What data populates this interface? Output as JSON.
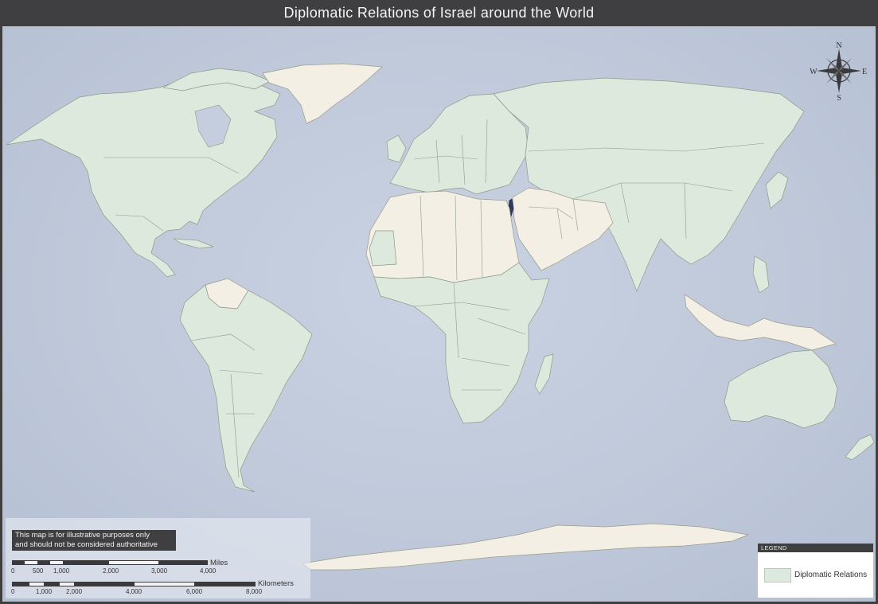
{
  "title": "Diplomatic Relations of Israel around the World",
  "compass": {
    "north": "N",
    "south": "S",
    "east": "E",
    "west": "W"
  },
  "colors": {
    "ocean": "#c4cede",
    "relations": "#dce9dc",
    "no_relations": "#f3efe4",
    "israel": "#2e3a5c",
    "bar": "#3f3f41"
  },
  "disclaimer": {
    "line1": "This map is for illustrative purposes only",
    "line2": "and should not be considered authoritative"
  },
  "scale": {
    "miles": {
      "unit": "Miles",
      "ticks": [
        "0",
        "500",
        "1,000",
        "2,000",
        "3,000",
        "4,000"
      ]
    },
    "kilometers": {
      "unit": "Kilometers",
      "ticks": [
        "0",
        "1,000",
        "2,000",
        "4,000",
        "6,000",
        "8,000"
      ]
    }
  },
  "legend": {
    "header": "LEGEND",
    "items": [
      {
        "label": "Diplomatic Relations",
        "color": "#dde9df"
      }
    ]
  }
}
